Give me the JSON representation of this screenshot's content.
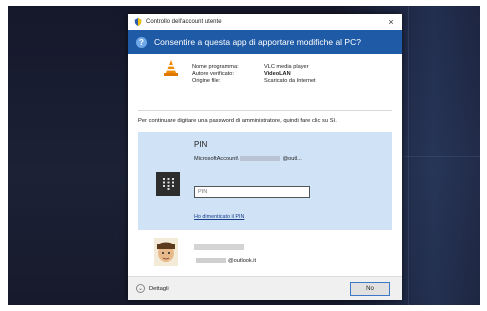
{
  "window": {
    "title": "Controllo dell'account utente",
    "close_glyph": "×"
  },
  "banner": {
    "question_glyph": "?",
    "text": "Consentire a questa app di apportare modifiche al PC?"
  },
  "app_info": {
    "labels": [
      "Nome programma:",
      "Autore verificato:",
      "Origine file:"
    ],
    "values": [
      "VLC media player",
      "VideoLAN",
      "Scaricato da Internet"
    ]
  },
  "instruction": "Per continuare digitare una password di amministratore, quindi fare clic su Sì.",
  "pin": {
    "title": "PIN",
    "account_prefix": "MicrosoftAccount\\",
    "account_suffix": "@outl...",
    "placeholder": "PIN",
    "forgot_link": "Ho dimenticato il PIN"
  },
  "user": {
    "email_suffix": "@outlook.it"
  },
  "footer": {
    "details_label": "Dettagli",
    "no_button": "No"
  },
  "colors": {
    "banner": "#1e5aa6",
    "pin_panel": "#cfe2f6",
    "desktop": "#1c2136"
  },
  "icons": [
    "shield-uac-icon",
    "question-icon",
    "vlc-cone-icon",
    "keypad-icon",
    "user-avatar-icon",
    "chevron-down-icon"
  ]
}
